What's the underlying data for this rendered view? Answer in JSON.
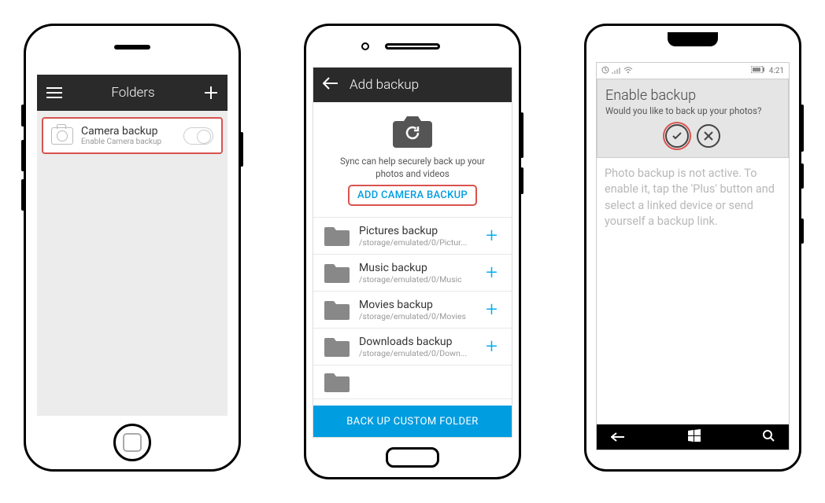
{
  "ios": {
    "header": {
      "title": "Folders"
    },
    "item": {
      "title": "Camera backup",
      "subtitle": "Enable Camera backup"
    }
  },
  "android": {
    "header": {
      "title": "Add backup"
    },
    "hero": {
      "desc": "Sync can help securely back up your photos and videos",
      "cta": "ADD CAMERA BACKUP"
    },
    "folders": [
      {
        "title": "Pictures backup",
        "path": "/storage/emulated/0/Pictur..."
      },
      {
        "title": "Music backup",
        "path": "/storage/emulated/0/Music"
      },
      {
        "title": "Movies backup",
        "path": "/storage/emulated/0/Movies"
      },
      {
        "title": "Downloads backup",
        "path": "/storage/emulated/0/Down..."
      }
    ],
    "bottom_cta": "BACK UP CUSTOM FOLDER"
  },
  "wp": {
    "status": {
      "time": "4:21"
    },
    "dialog": {
      "title": "Enable backup",
      "subtitle": "Would you like to back up your photos?"
    },
    "body": "Photo backup is not active. To enable it, tap the 'Plus' button and select a linked device or send yourself a backup link."
  }
}
